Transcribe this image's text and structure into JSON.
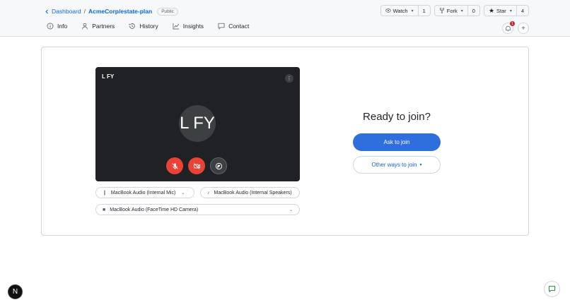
{
  "header": {
    "back_label": "Dashboard",
    "separator": "/",
    "repo": "AcmeCorp/estate-plan",
    "visibility": "Public",
    "watch": {
      "label": "Watch",
      "count": "1"
    },
    "fork": {
      "label": "Fork",
      "count": "0"
    },
    "star": {
      "label": "Star",
      "count": "4"
    },
    "notification_count": "1"
  },
  "tabs": [
    {
      "label": "Info",
      "icon": "info-icon"
    },
    {
      "label": "Partners",
      "icon": "person-icon"
    },
    {
      "label": "History",
      "icon": "history-icon"
    },
    {
      "label": "Insights",
      "icon": "graph-icon"
    },
    {
      "label": "Contact",
      "icon": "chat-icon"
    }
  ],
  "video": {
    "name": "L FY",
    "avatar_initials": "L FY"
  },
  "devices": {
    "mic": "MacBook Audio (Internal Mic)",
    "speaker": "MacBook Audio (Internal Speakers)",
    "camera": "MacBook Audio (FaceTime HD Camera)"
  },
  "join": {
    "title": "Ready to join?",
    "ask_label": "Ask to join",
    "other_label": "Other ways to join"
  },
  "footer": {
    "next_badge": "N"
  },
  "colors": {
    "accent": "#2f6fdd",
    "danger": "#ea4335",
    "video_bg": "#202124"
  }
}
